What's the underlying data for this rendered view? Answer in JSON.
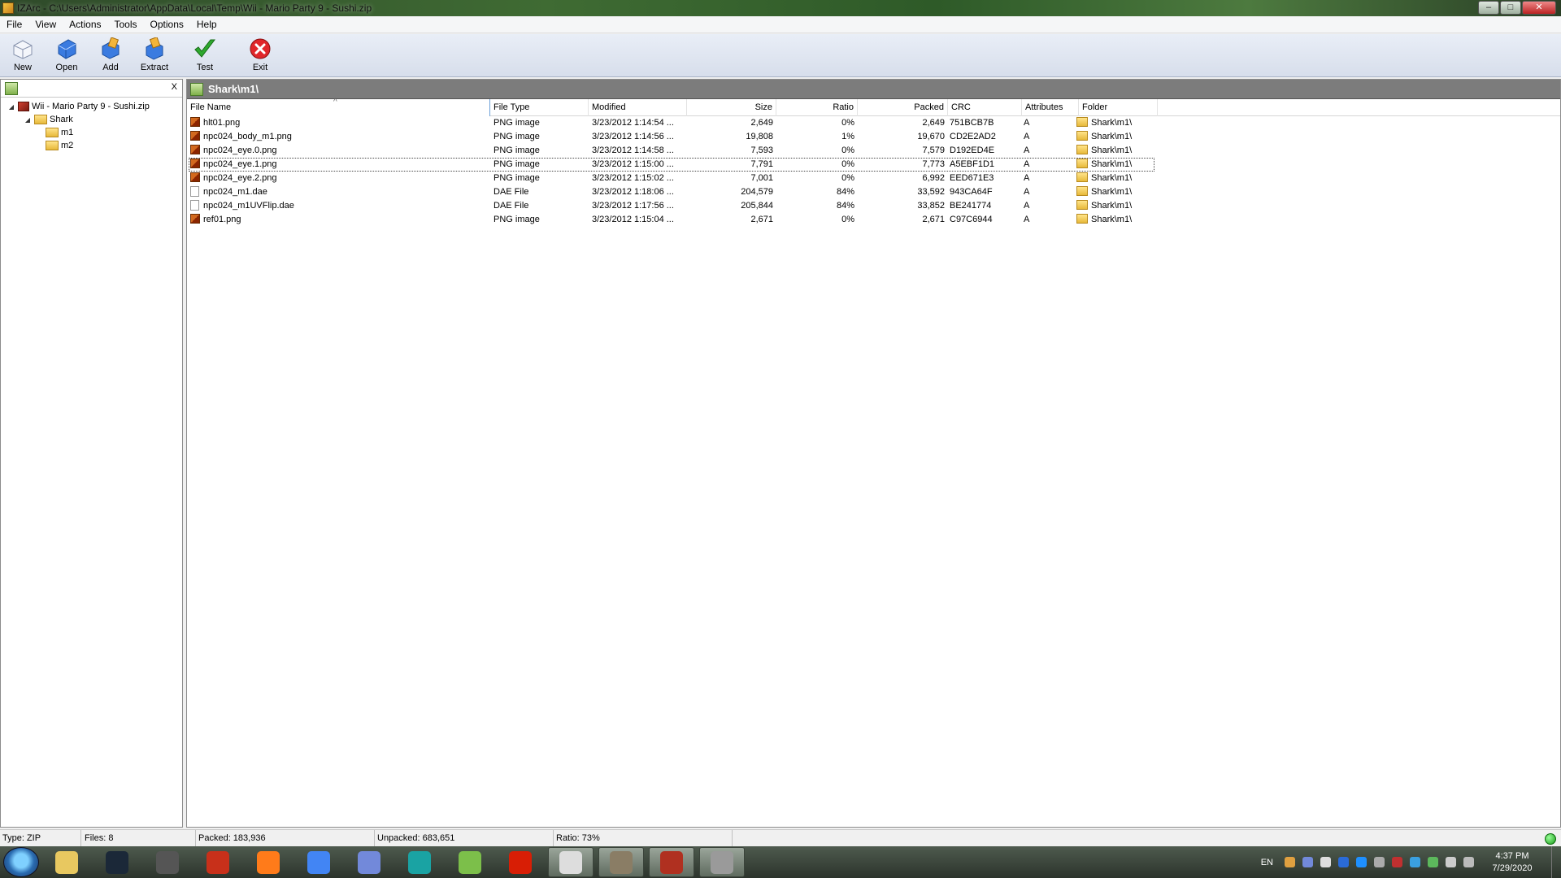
{
  "window": {
    "title": "IZArc - C:\\Users\\Administrator\\AppData\\Local\\Temp\\Wii - Mario Party 9 - Sushi.zip",
    "minimize": "–",
    "maximize": "□",
    "close": "✕"
  },
  "menu": [
    "File",
    "View",
    "Actions",
    "Tools",
    "Options",
    "Help"
  ],
  "toolbar": [
    {
      "label": "New",
      "icon": "new-icon"
    },
    {
      "label": "Open",
      "icon": "open-icon"
    },
    {
      "label": "Add",
      "icon": "add-icon"
    },
    {
      "label": "Extract",
      "icon": "extract-icon"
    },
    {
      "label": "Test",
      "icon": "test-check-icon"
    },
    {
      "label": "Exit",
      "icon": "exit-icon"
    }
  ],
  "tree": {
    "close_label": "X",
    "nodes": [
      {
        "label": "Wii - Mario Party 9 - Sushi.zip",
        "level": 0,
        "arrow": "◢",
        "type": "archive"
      },
      {
        "label": "Shark",
        "level": 1,
        "arrow": "◢",
        "type": "folder"
      },
      {
        "label": "m1",
        "level": 2,
        "arrow": "",
        "type": "folder"
      },
      {
        "label": "m2",
        "level": 2,
        "arrow": "",
        "type": "folder"
      }
    ]
  },
  "path": "Shark\\m1\\",
  "columns": [
    "File Name",
    "File Type",
    "Modified",
    "Size",
    "Ratio",
    "Packed",
    "CRC",
    "Attributes",
    "Folder"
  ],
  "files": [
    {
      "name": "hlt01.png",
      "type": "PNG image",
      "modified": "3/23/2012 1:14:54 ...",
      "size": "2,649",
      "ratio": "0%",
      "packed": "2,649",
      "crc": "751BCB7B",
      "attr": "A",
      "folder": "Shark\\m1\\",
      "icon": "png"
    },
    {
      "name": "npc024_body_m1.png",
      "type": "PNG image",
      "modified": "3/23/2012 1:14:56 ...",
      "size": "19,808",
      "ratio": "1%",
      "packed": "19,670",
      "crc": "CD2E2AD2",
      "attr": "A",
      "folder": "Shark\\m1\\",
      "icon": "png"
    },
    {
      "name": "npc024_eye.0.png",
      "type": "PNG image",
      "modified": "3/23/2012 1:14:58 ...",
      "size": "7,593",
      "ratio": "0%",
      "packed": "7,579",
      "crc": "D192ED4E",
      "attr": "A",
      "folder": "Shark\\m1\\",
      "icon": "png"
    },
    {
      "name": "npc024_eye.1.png",
      "type": "PNG image",
      "modified": "3/23/2012 1:15:00 ...",
      "size": "7,791",
      "ratio": "0%",
      "packed": "7,773",
      "crc": "A5EBF1D1",
      "attr": "A",
      "folder": "Shark\\m1\\",
      "icon": "png"
    },
    {
      "name": "npc024_eye.2.png",
      "type": "PNG image",
      "modified": "3/23/2012 1:15:02 ...",
      "size": "7,001",
      "ratio": "0%",
      "packed": "6,992",
      "crc": "EED671E3",
      "attr": "A",
      "folder": "Shark\\m1\\",
      "icon": "png"
    },
    {
      "name": "npc024_m1.dae",
      "type": "DAE File",
      "modified": "3/23/2012 1:18:06 ...",
      "size": "204,579",
      "ratio": "84%",
      "packed": "33,592",
      "crc": "943CA64F",
      "attr": "A",
      "folder": "Shark\\m1\\",
      "icon": "dae"
    },
    {
      "name": "npc024_m1UVFlip.dae",
      "type": "DAE File",
      "modified": "3/23/2012 1:17:56 ...",
      "size": "205,844",
      "ratio": "84%",
      "packed": "33,852",
      "crc": "BE241774",
      "attr": "A",
      "folder": "Shark\\m1\\",
      "icon": "dae"
    },
    {
      "name": "ref01.png",
      "type": "PNG image",
      "modified": "3/23/2012 1:15:04 ...",
      "size": "2,671",
      "ratio": "0%",
      "packed": "2,671",
      "crc": "C97C6944",
      "attr": "A",
      "folder": "Shark\\m1\\",
      "icon": "png"
    }
  ],
  "focused_row": 3,
  "status": {
    "type": "Type: ZIP",
    "files": "Files: 8",
    "packed": "Packed: 183,936",
    "unpacked": "Unpacked: 683,651",
    "ratio": "Ratio: 73%"
  },
  "taskbar": {
    "apps": [
      {
        "name": "explorer",
        "color": "#e8c860"
      },
      {
        "name": "steam",
        "color": "#1b2838"
      },
      {
        "name": "app-gear",
        "color": "#555555"
      },
      {
        "name": "app-red",
        "color": "#c8301a"
      },
      {
        "name": "firefox",
        "color": "#ff7b1a"
      },
      {
        "name": "chrome",
        "color": "#4285f4"
      },
      {
        "name": "discord",
        "color": "#7289da"
      },
      {
        "name": "app-3",
        "color": "#1aa3a3"
      },
      {
        "name": "notepad",
        "color": "#7cbf4a"
      },
      {
        "name": "acrobat",
        "color": "#d81e05"
      },
      {
        "name": "app-alien",
        "color": "#dddddd"
      },
      {
        "name": "gimp",
        "color": "#8a7d65"
      },
      {
        "name": "app-monkey",
        "color": "#b03020"
      },
      {
        "name": "izarc",
        "color": "#9a9a9a"
      }
    ],
    "active_apps": [
      10,
      11,
      12,
      13
    ],
    "lang": "EN",
    "time": "4:37 PM",
    "date": "7/29/2020"
  }
}
